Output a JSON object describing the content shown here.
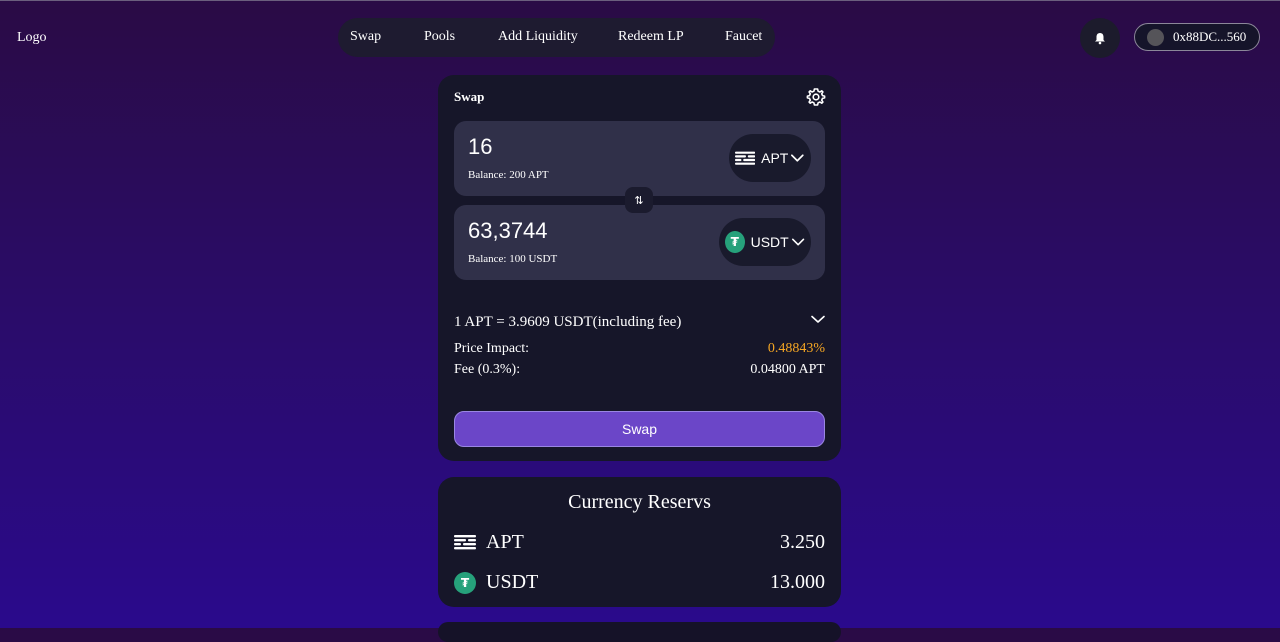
{
  "header": {
    "logo": "Logo",
    "nav": [
      "Swap",
      "Pools",
      "Add Liquidity",
      "Redeem LP",
      "Faucet"
    ],
    "wallet_address": "0x88DC...560"
  },
  "swap": {
    "title": "Swap",
    "from": {
      "amount": "16",
      "token": "APT",
      "balance": "Balance: 200 APT"
    },
    "to": {
      "amount": "63,3744",
      "token": "USDT",
      "balance": "Balance: 100 USDT"
    },
    "rate": "1 APT = 3.9609 USDT(including fee)",
    "price_impact_label": "Price Impact:",
    "price_impact_value": "0.48843%",
    "fee_label": "Fee (0.3%):",
    "fee_value": "0.04800 APT",
    "button": "Swap",
    "colors": {
      "accent": "#6b46c8",
      "impact": "#f5a623",
      "usdt": "#26a17b"
    }
  },
  "reserves": {
    "title": "Currency Reservs",
    "items": [
      {
        "token": "APT",
        "amount": "3.250",
        "icon": "apt-icon"
      },
      {
        "token": "USDT",
        "amount": "13.000",
        "icon": "usdt-icon"
      }
    ]
  }
}
